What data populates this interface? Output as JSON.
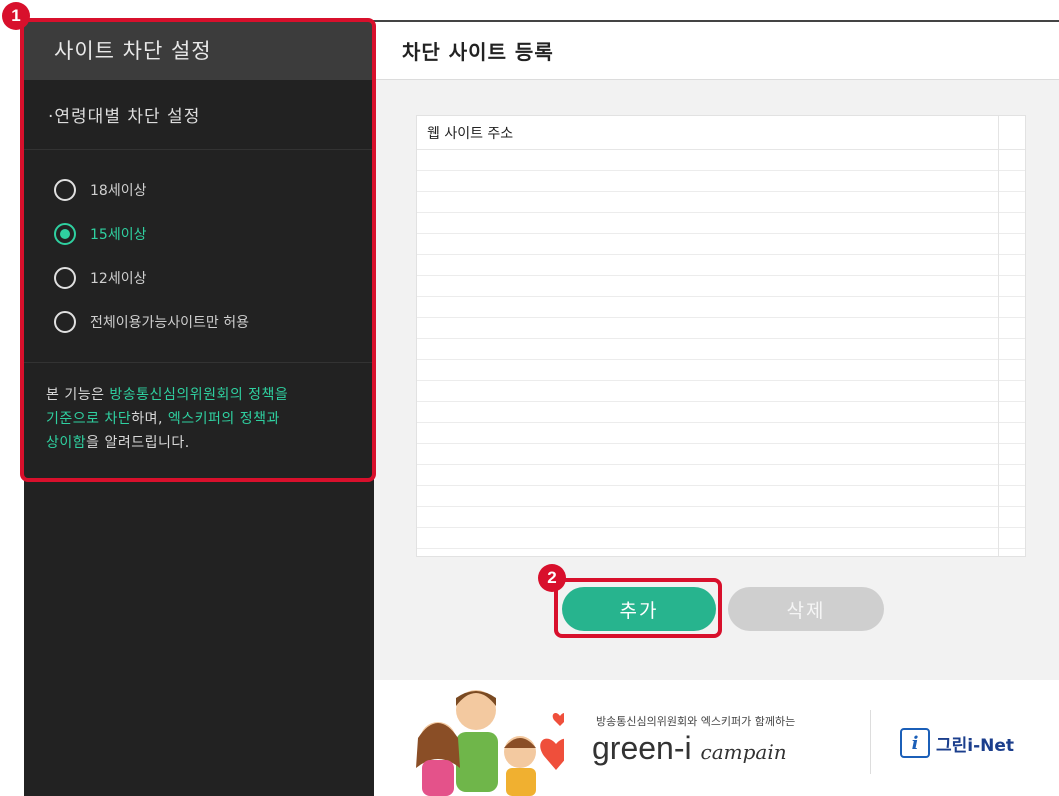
{
  "sidebar": {
    "title": "사이트 차단 설정",
    "section_title": "·연령대별 차단 설정",
    "options": [
      {
        "label": "18세이상",
        "selected": false
      },
      {
        "label": "15세이상",
        "selected": true
      },
      {
        "label": "12세이상",
        "selected": false
      },
      {
        "label": "전체이용가능사이트만 허용",
        "selected": false
      }
    ],
    "notice_parts": {
      "p1": "본 기능은 ",
      "h1": "방송통신심의위원회의 정책을",
      "p2": " ",
      "h2": "기준으로 차단",
      "p3": "하며, ",
      "h3": "엑스키퍼의 정책과",
      "p4": " ",
      "h4": "상이함",
      "p5": "을 알려드립니다."
    }
  },
  "main": {
    "title": "차단 사이트 등록",
    "table_header": "웹 사이트 주소",
    "add_button": "추가",
    "delete_button": "삭제"
  },
  "banner": {
    "subtitle": "방송통신심의위원회와 엑스키퍼가 함께하는",
    "campaign_main": "green-i",
    "campaign_script": "campain",
    "logo_mark": "i",
    "logo_text": "그린i-Net"
  },
  "annotations": {
    "badge1": "1",
    "badge2": "2"
  },
  "colors": {
    "accent": "#2fd0a0",
    "button_add": "#27b48e",
    "annotation": "#d8102c"
  }
}
